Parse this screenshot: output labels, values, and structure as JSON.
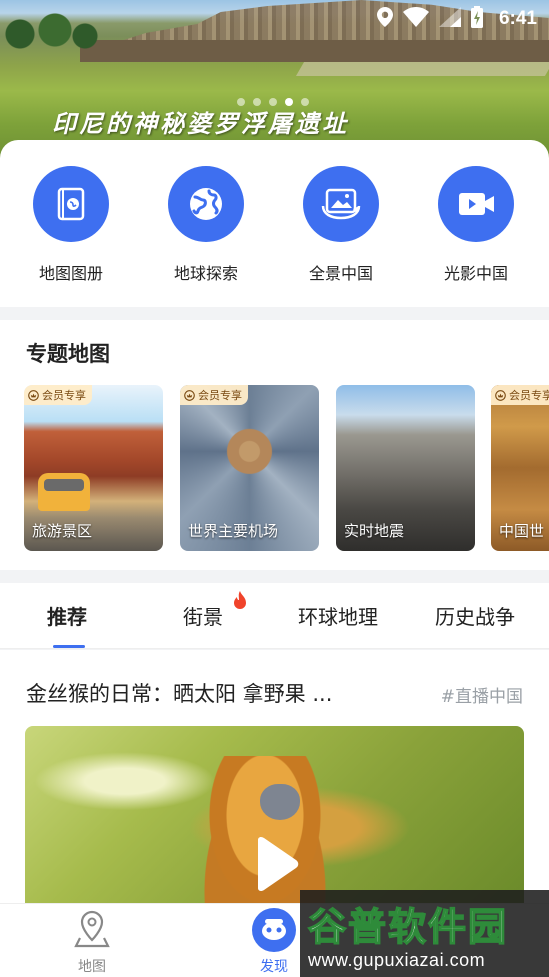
{
  "status_bar": {
    "time": "6:41",
    "icons": [
      "location-icon",
      "wifi-icon",
      "signal-icon",
      "battery-charging-icon"
    ]
  },
  "banner": {
    "caption": "印尼的神秘婆罗浮屠遗址",
    "dots_total": 5,
    "active_dot_index": 3
  },
  "quick_actions": [
    {
      "label": "地图图册",
      "icon": "atlas-book-icon"
    },
    {
      "label": "地球探索",
      "icon": "globe-icon"
    },
    {
      "label": "全景中国",
      "icon": "panorama-icon"
    },
    {
      "label": "光影中国",
      "icon": "video-camera-icon"
    }
  ],
  "topic_section": {
    "title": "专题地图",
    "vip_badge": "会员专享",
    "cards": [
      {
        "label": "旅游景区",
        "vip": true
      },
      {
        "label": "世界主要机场",
        "vip": true
      },
      {
        "label": "实时地震",
        "vip": false
      },
      {
        "label": "中国世",
        "vip": true
      }
    ]
  },
  "tabs": [
    {
      "label": "推荐",
      "active": true
    },
    {
      "label": "街景",
      "active": false,
      "hot": true
    },
    {
      "label": "环球地理",
      "active": false
    },
    {
      "label": "历史战争",
      "active": false
    }
  ],
  "feed": {
    "title": "金丝猴的日常：晒太阳 拿野果 ...",
    "tag": "#直播中国"
  },
  "bottom_nav": [
    {
      "label": "地图",
      "icon": "map-pin-icon",
      "active": false
    },
    {
      "label": "发现",
      "icon": "discover-icon",
      "active": true
    }
  ],
  "watermark": {
    "logo": "谷普软件园",
    "url": "www.gupuxiazai.com"
  },
  "colors": {
    "accent": "#3e6ff0",
    "background": "#f2f3f5",
    "vip_badge_bg": "#ffecc8",
    "vip_badge_text": "#7a4a12",
    "tag_gray": "#9aa0a6",
    "fire_red": "#f0432b"
  }
}
